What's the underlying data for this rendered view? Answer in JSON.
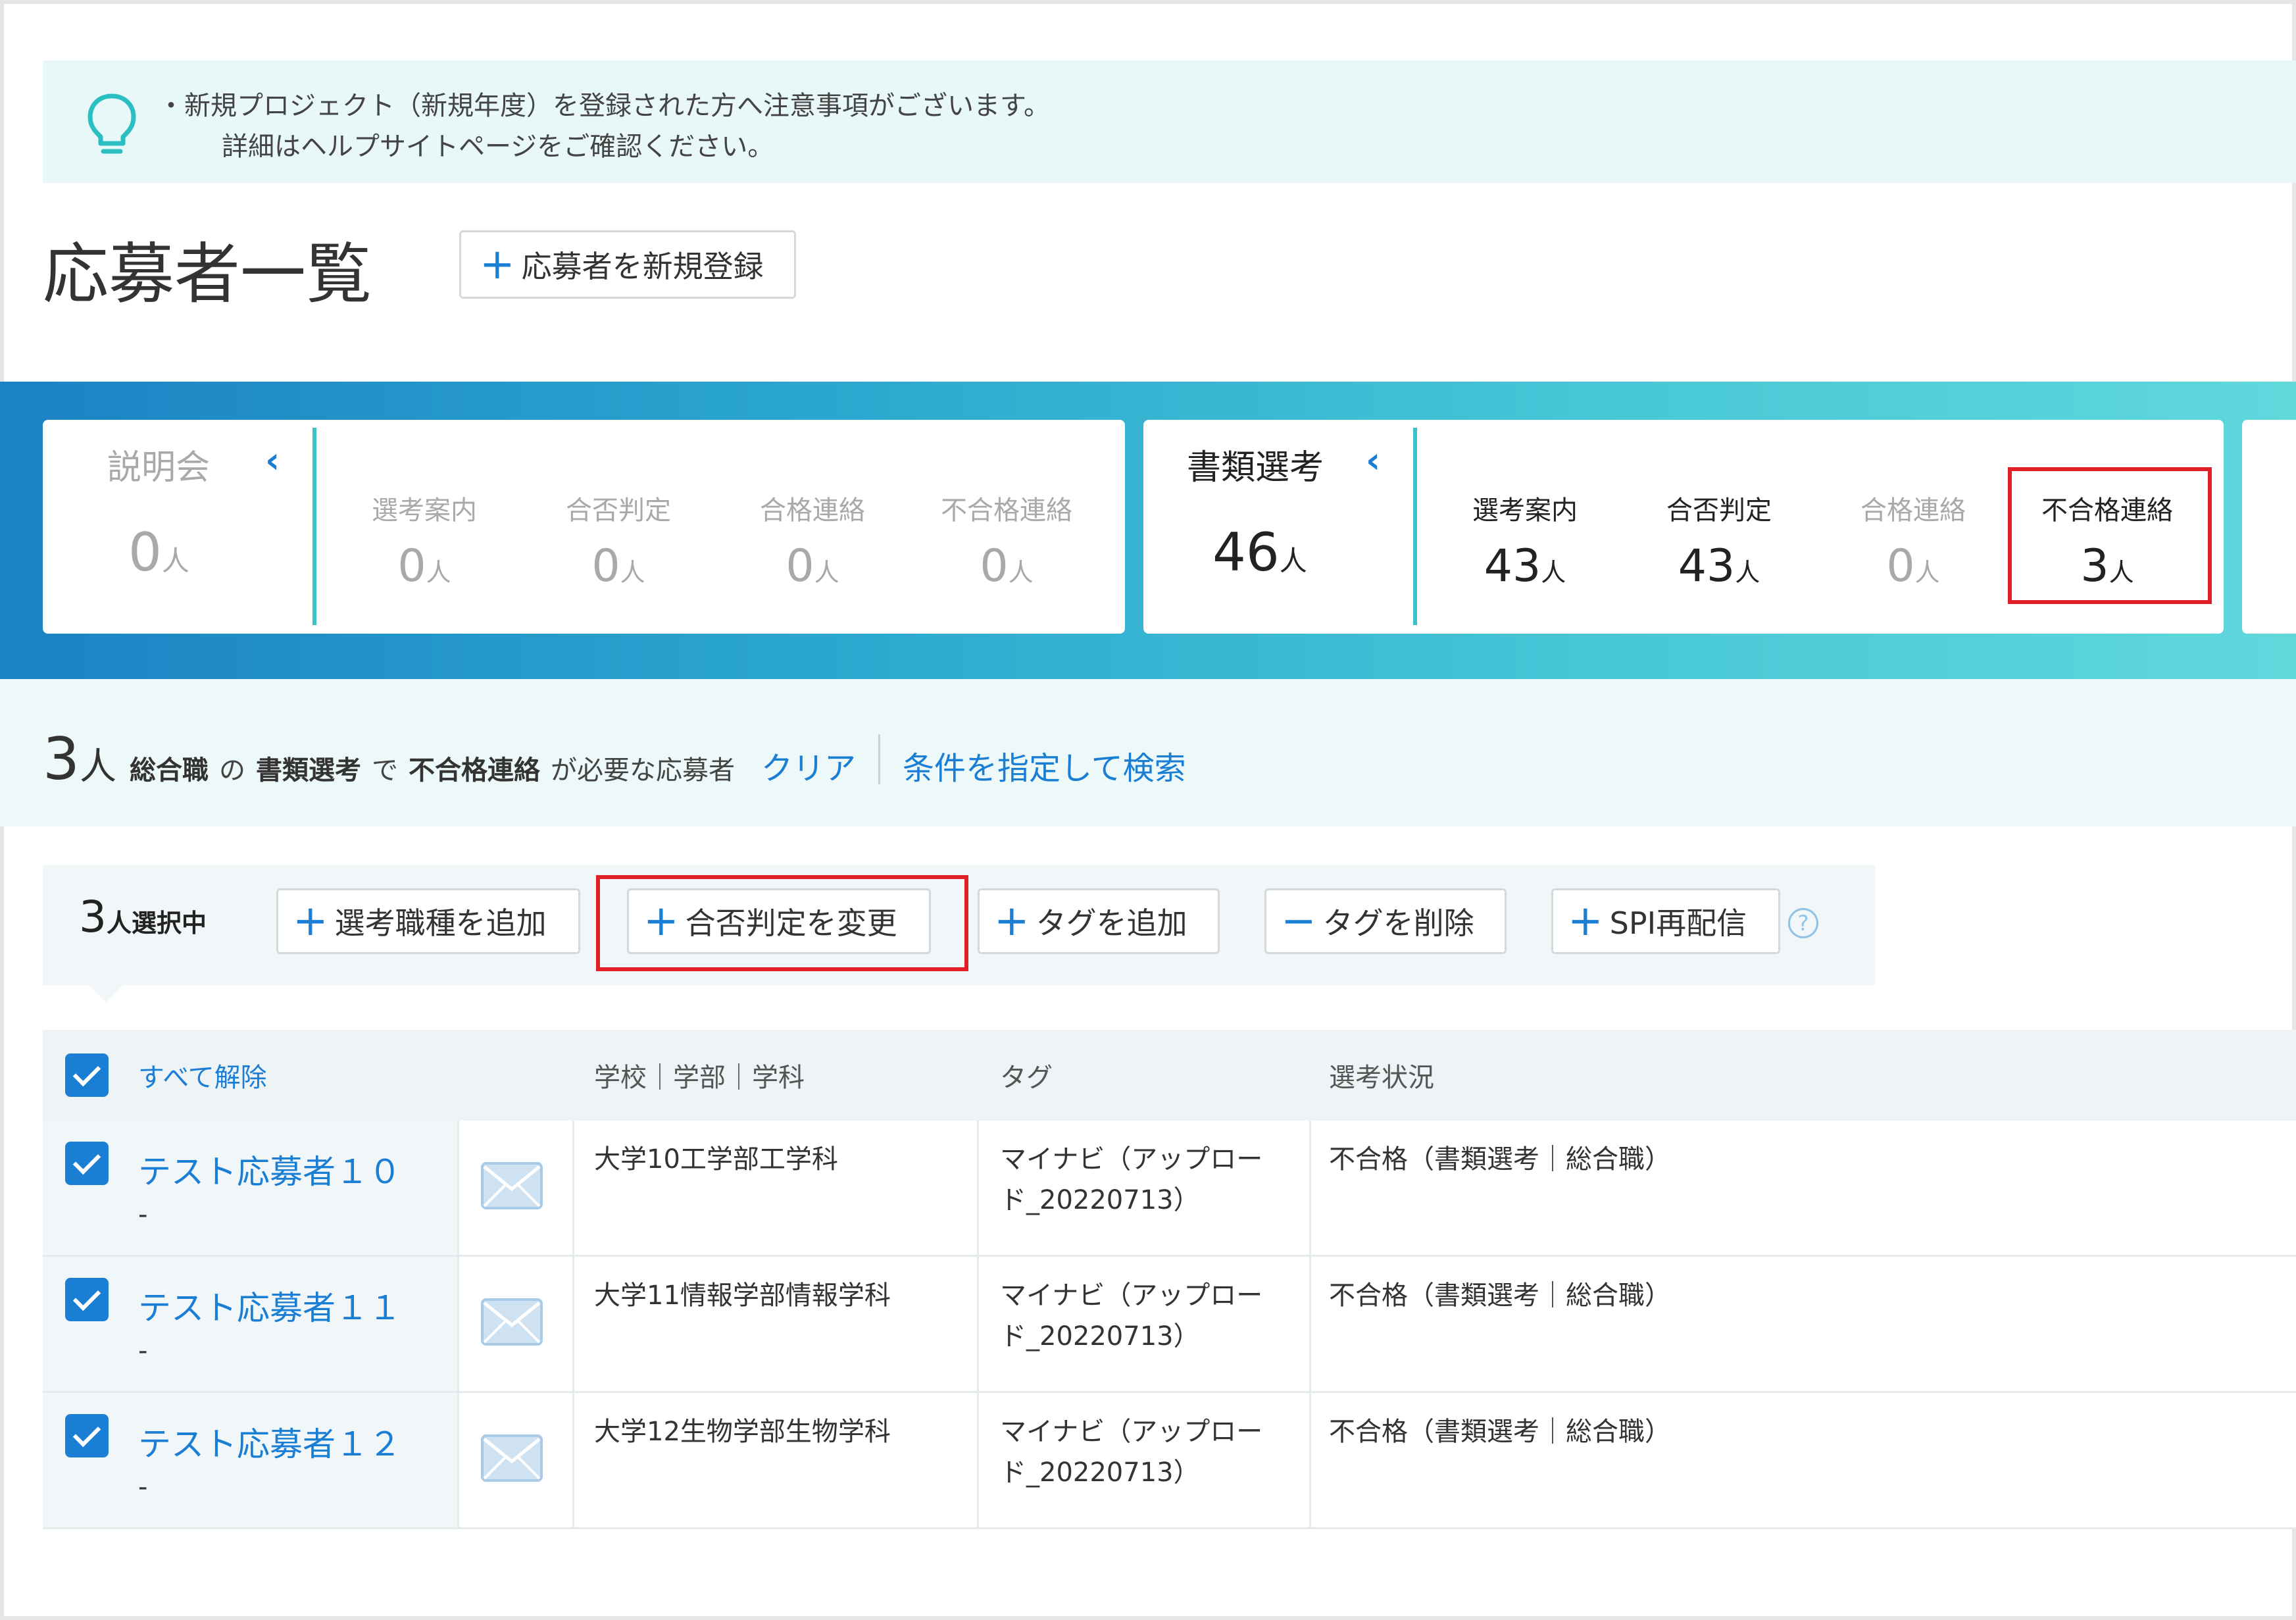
{
  "notice": {
    "line1": "・新規プロジェクト（新規年度）を登録された方へ注意事項がございます。",
    "line2": "詳細はヘルプサイトページをご確認ください。"
  },
  "page": {
    "title": "応募者一覧",
    "register_button": "応募者を新規登録"
  },
  "pipeline": {
    "unit": "人",
    "stages": [
      {
        "name": "説明会",
        "count": "0",
        "substages": [
          {
            "label": "選考案内",
            "count": "0"
          },
          {
            "label": "合否判定",
            "count": "0"
          },
          {
            "label": "合格連絡",
            "count": "0"
          },
          {
            "label": "不合格連絡",
            "count": "0"
          }
        ]
      },
      {
        "name": "書類選考",
        "count": "46",
        "substages": [
          {
            "label": "選考案内",
            "count": "43"
          },
          {
            "label": "合否判定",
            "count": "43"
          },
          {
            "label": "合格連絡",
            "count": "0"
          },
          {
            "label": "不合格連絡",
            "count": "3"
          }
        ]
      }
    ]
  },
  "filter": {
    "count": "3",
    "unit": "人",
    "job": "総合職",
    "particle1": "の",
    "stage": "書類選考",
    "particle2": "で",
    "status": "不合格連絡",
    "suffix": "が必要な応募者",
    "clear": "クリア",
    "search": "条件を指定して検索"
  },
  "actions": {
    "selected_count": "3",
    "selected_suffix": "人選択中",
    "add_job": "選考職種を追加",
    "change_judgement": "合否判定を変更",
    "add_tag": "タグを追加",
    "remove_tag": "タグを削除",
    "spi_resend": "SPI再配信",
    "help": "?"
  },
  "table": {
    "headers": {
      "deselect_all": "すべて解除",
      "school": "学校｜学部｜学科",
      "tag": "タグ",
      "status": "選考状況"
    },
    "rows": [
      {
        "name": "テスト応募者１０",
        "sub": "-",
        "school": "大学10工学部工学科",
        "tag_line1": "マイナビ（アップロー",
        "tag_line2": "ド_20220713）",
        "status": "不合格（書類選考｜総合職）"
      },
      {
        "name": "テスト応募者１１",
        "sub": "-",
        "school": "大学11情報学部情報学科",
        "tag_line1": "マイナビ（アップロー",
        "tag_line2": "ド_20220713）",
        "status": "不合格（書類選考｜総合職）"
      },
      {
        "name": "テスト応募者１２",
        "sub": "-",
        "school": "大学12生物学部生物学科",
        "tag_line1": "マイナビ（アップロー",
        "tag_line2": "ド_20220713）",
        "status": "不合格（書類選考｜総合職）"
      }
    ]
  },
  "colors": {
    "accent": "#1a7fd4",
    "highlight": "#e01f26",
    "teal": "#39c3c8"
  }
}
